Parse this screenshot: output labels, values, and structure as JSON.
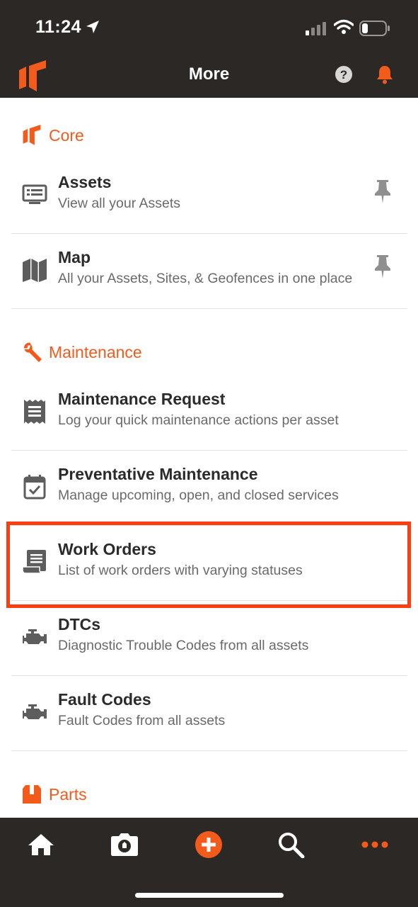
{
  "status_bar": {
    "time": "11:24"
  },
  "nav": {
    "title": "More"
  },
  "colors": {
    "accent": "#f35b1d",
    "dark": "#2c2825",
    "highlight": "#fc3d12"
  },
  "sections": {
    "core": {
      "label": "Core",
      "icon": "brand-logo-icon",
      "items": [
        {
          "title": "Assets",
          "subtitle": "View all your Assets",
          "icon": "monitor-list-icon",
          "pinned": true
        },
        {
          "title": "Map",
          "subtitle": "All your Assets, Sites, & Geofences in one place",
          "icon": "map-icon",
          "pinned": true
        }
      ]
    },
    "maintenance": {
      "label": "Maintenance",
      "icon": "wrench-icon",
      "items": [
        {
          "title": "Maintenance Request",
          "subtitle": "Log your quick maintenance actions per asset",
          "icon": "receipt-icon"
        },
        {
          "title": "Preventative Maintenance",
          "subtitle": "Manage upcoming, open, and closed services",
          "icon": "calendar-check-icon"
        },
        {
          "title": "Work Orders",
          "subtitle": "List of work orders with varying statuses",
          "icon": "work-order-icon",
          "highlighted": true
        },
        {
          "title": "DTCs",
          "subtitle": "Diagnostic Trouble Codes from all assets",
          "icon": "engine-icon"
        },
        {
          "title": "Fault Codes",
          "subtitle": "Fault Codes from all assets",
          "icon": "engine-icon"
        }
      ]
    },
    "parts": {
      "label": "Parts",
      "icon": "box-icon"
    }
  },
  "tabs": [
    "home-icon",
    "camera-icon",
    "add-icon",
    "search-icon",
    "more-icon"
  ]
}
